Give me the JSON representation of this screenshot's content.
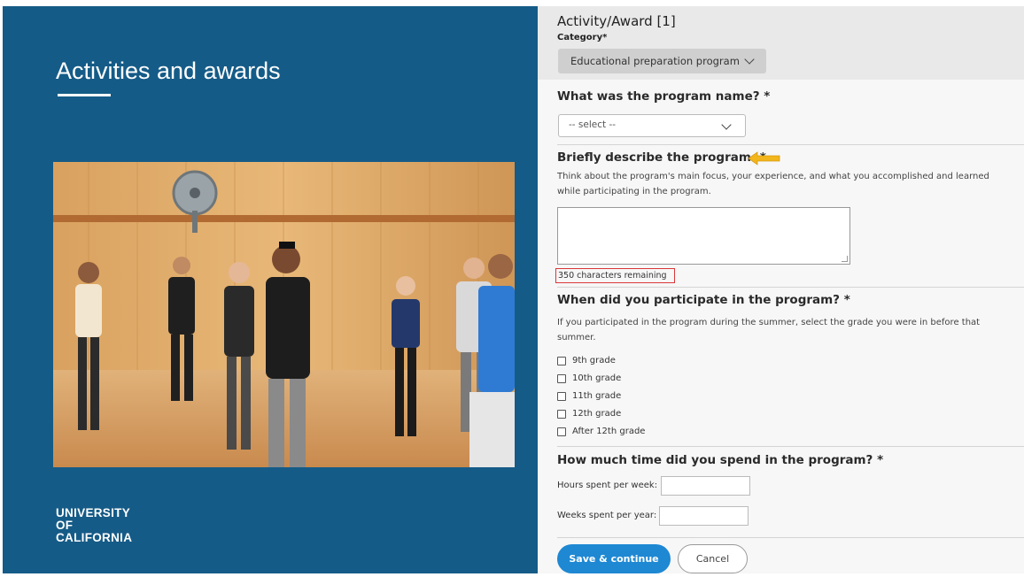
{
  "slide": {
    "title": "Activities and awards",
    "logo": {
      "line1": "UNIVERSITY",
      "line2": "OF",
      "line3": "CALIFORNIA"
    },
    "brand_color": "#155b87"
  },
  "form": {
    "activity_title": "Activity/Award [1]",
    "category_label": "Category*",
    "category_value": "Educational preparation program",
    "program_name_question": "What was the program name? *",
    "program_name_select": "-- select --",
    "describe_question": "Briefly describe the program. *",
    "describe_help": "Think about the program's main focus, your experience, and what you accomplished and learned while participating in the program.",
    "chars_remaining": "350 characters remaining",
    "participate_question": "When did you participate in the program? *",
    "participate_help": "If you participated in the program during the summer, select the grade you were in before that summer.",
    "grades": [
      "9th grade",
      "10th grade",
      "11th grade",
      "12th grade",
      "After 12th grade"
    ],
    "time_question": "How much time did you spend in the program? *",
    "hours_label": "Hours spent per week:",
    "weeks_label": "Weeks spent per year:",
    "save_label": "Save & continue",
    "cancel_label": "Cancel",
    "accent_color": "#1e88d3",
    "arrow_color": "#f2b51b"
  }
}
